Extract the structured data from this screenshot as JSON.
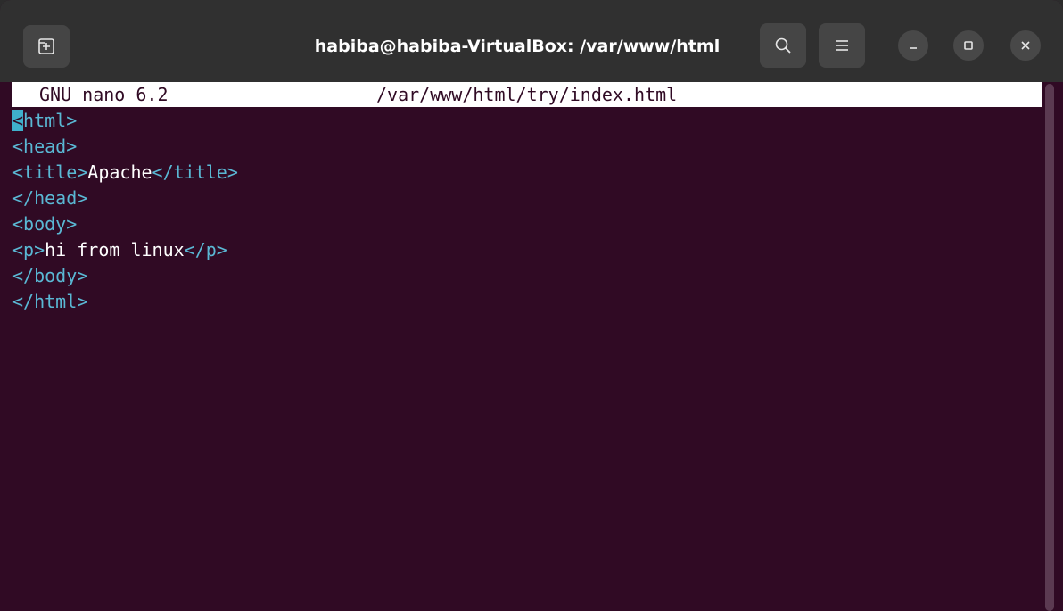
{
  "window": {
    "title": "habiba@habiba-VirtualBox: /var/www/html"
  },
  "headerbar": {
    "icons": {
      "new_tab": "new-tab-icon",
      "search": "search-icon",
      "menu": "hamburger-menu-icon",
      "minimize": "minimize-icon",
      "maximize": "maximize-icon",
      "close": "close-icon"
    }
  },
  "nano": {
    "version": "GNU nano 6.2",
    "filename": "/var/www/html/try/index.html"
  },
  "code": {
    "line1": {
      "cursor_char": "<",
      "rest": "html>"
    },
    "line2": {
      "text": "<head>"
    },
    "line3": {
      "open": "<title>",
      "content": "Apache",
      "close": "</title>"
    },
    "line4": {
      "text": "</head>"
    },
    "line5": {
      "text": "<body>"
    },
    "line6": {
      "open": "<p>",
      "content": "hi from linux",
      "close": "</p>"
    },
    "line7": {
      "text": "</body>"
    },
    "line8": {
      "text": "</html>"
    }
  },
  "colors": {
    "terminal_bg": "#300a24",
    "tag_color": "#5ab8d4",
    "text_color": "#ffffff",
    "cursor_color": "#3fb0cc",
    "headerbar_bg": "#303030"
  }
}
